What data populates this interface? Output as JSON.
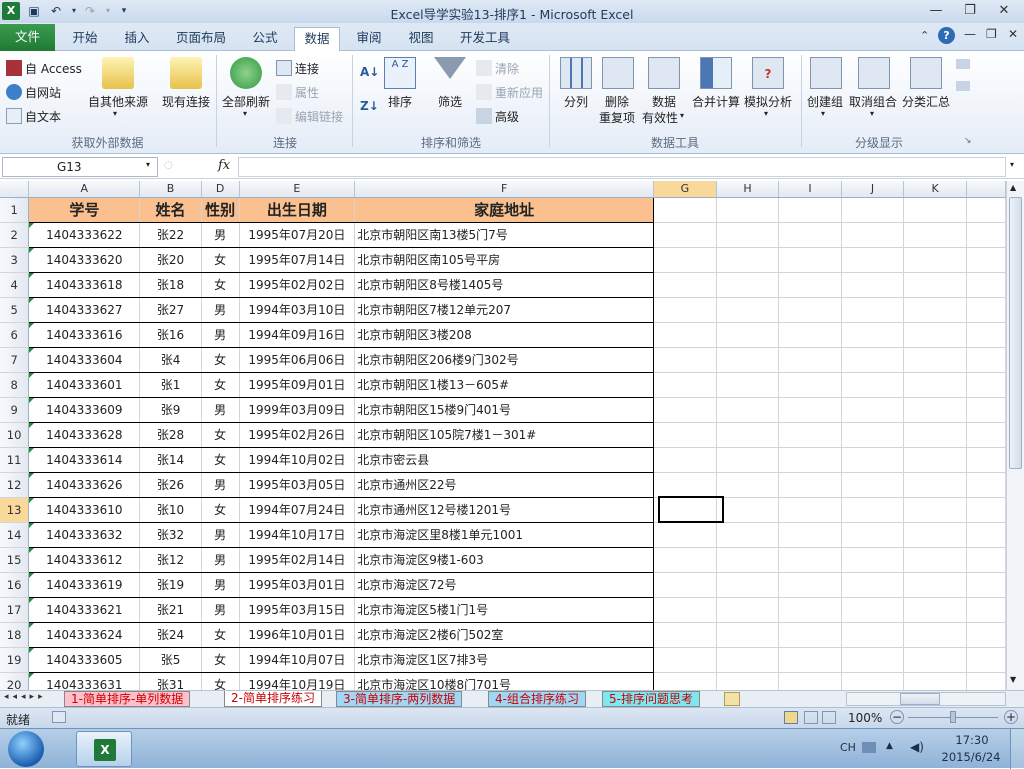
{
  "window": {
    "title": "Excel导学实验13-排序1  -  Microsoft Excel"
  },
  "tabs": [
    {
      "label": "文件"
    },
    {
      "label": "开始"
    },
    {
      "label": "插入"
    },
    {
      "label": "页面布局"
    },
    {
      "label": "公式"
    },
    {
      "label": "数据"
    },
    {
      "label": "审阅"
    },
    {
      "label": "视图"
    },
    {
      "label": "开发工具"
    }
  ],
  "ribbon": {
    "ext": {
      "access": "自 Access",
      "web": "自网站",
      "text": "自文本",
      "other": "自其他来源",
      "existing": "现有连接",
      "label": "获取外部数据"
    },
    "conn": {
      "refresh": "全部刷新",
      "connections": "连接",
      "properties": "属性",
      "edit_links": "编辑链接",
      "label": "连接"
    },
    "sort": {
      "sort": "排序",
      "filter": "筛选",
      "clear": "清除",
      "reapply": "重新应用",
      "advanced": "高级",
      "label": "排序和筛选"
    },
    "tools": {
      "split": "分列",
      "remove1": "删除",
      "remove2": "重复项",
      "valid1": "数据",
      "valid2": "有效性",
      "consolidate": "合并计算",
      "whatif": "模拟分析",
      "label": "数据工具"
    },
    "outline": {
      "group": "创建组",
      "ungroup": "取消组合",
      "subtotal": "分类汇总",
      "label": "分级显示"
    }
  },
  "formula_bar": {
    "name_box": "G13",
    "fx": "fx",
    "content": ""
  },
  "columns": [
    "A",
    "B",
    "D",
    "E",
    "F",
    "G",
    "H",
    "I",
    "J",
    "K"
  ],
  "header_row": {
    "id": "学号",
    "name": "姓名",
    "gender": "性别",
    "birth": "出生日期",
    "address": "家庭地址"
  },
  "rows": [
    {
      "n": "2",
      "id": "1404333622",
      "name": "张22",
      "g": "男",
      "b": "1995年07月20日",
      "a": "北京市朝阳区南13楼5门7号"
    },
    {
      "n": "3",
      "id": "1404333620",
      "name": "张20",
      "g": "女",
      "b": "1995年07月14日",
      "a": "北京市朝阳区南105号平房"
    },
    {
      "n": "4",
      "id": "1404333618",
      "name": "张18",
      "g": "女",
      "b": "1995年02月02日",
      "a": "北京市朝阳区8号楼1405号"
    },
    {
      "n": "5",
      "id": "1404333627",
      "name": "张27",
      "g": "男",
      "b": "1994年03月10日",
      "a": "北京市朝阳区7楼12单元207"
    },
    {
      "n": "6",
      "id": "1404333616",
      "name": "张16",
      "g": "男",
      "b": "1994年09月16日",
      "a": "北京市朝阳区3楼208"
    },
    {
      "n": "7",
      "id": "1404333604",
      "name": "张4",
      "g": "女",
      "b": "1995年06月06日",
      "a": "北京市朝阳区206楼9门302号"
    },
    {
      "n": "8",
      "id": "1404333601",
      "name": "张1",
      "g": "女",
      "b": "1995年09月01日",
      "a": "北京市朝阳区1楼13－605#"
    },
    {
      "n": "9",
      "id": "1404333609",
      "name": "张9",
      "g": "男",
      "b": "1999年03月09日",
      "a": "北京市朝阳区15楼9门401号"
    },
    {
      "n": "10",
      "id": "1404333628",
      "name": "张28",
      "g": "女",
      "b": "1995年02月26日",
      "a": "北京市朝阳区105院7楼1－301#"
    },
    {
      "n": "11",
      "id": "1404333614",
      "name": "张14",
      "g": "女",
      "b": "1994年10月02日",
      "a": "北京市密云县"
    },
    {
      "n": "12",
      "id": "1404333626",
      "name": "张26",
      "g": "男",
      "b": "1995年03月05日",
      "a": "北京市通州区22号"
    },
    {
      "n": "13",
      "id": "1404333610",
      "name": "张10",
      "g": "女",
      "b": "1994年07月24日",
      "a": "北京市通州区12号楼1201号"
    },
    {
      "n": "14",
      "id": "1404333632",
      "name": "张32",
      "g": "男",
      "b": "1994年10月17日",
      "a": "北京市海淀区里8楼1单元1001"
    },
    {
      "n": "15",
      "id": "1404333612",
      "name": "张12",
      "g": "男",
      "b": "1995年02月14日",
      "a": "北京市海淀区9楼1-603"
    },
    {
      "n": "16",
      "id": "1404333619",
      "name": "张19",
      "g": "男",
      "b": "1995年03月01日",
      "a": "北京市海淀区72号"
    },
    {
      "n": "17",
      "id": "1404333621",
      "name": "张21",
      "g": "男",
      "b": "1995年03月15日",
      "a": "北京市海淀区5楼1门1号"
    },
    {
      "n": "18",
      "id": "1404333624",
      "name": "张24",
      "g": "女",
      "b": "1996年10月01日",
      "a": "北京市海淀区2楼6门502室"
    },
    {
      "n": "19",
      "id": "1404333605",
      "name": "张5",
      "g": "女",
      "b": "1994年10月07日",
      "a": "北京市海淀区1区7排3号"
    },
    {
      "n": "20",
      "id": "1404333631",
      "name": "张31",
      "g": "女",
      "b": "1994年10月19日",
      "a": "北京市海淀区10楼8门701号"
    }
  ],
  "sheet_tabs": [
    {
      "label": "1-简单排序-单列数据",
      "color": "#ffc0cb"
    },
    {
      "label": "2-简单排序练习",
      "color": "#ffffff"
    },
    {
      "label": "3-简单排序-两列数据",
      "color": "#9fd7f5"
    },
    {
      "label": "4-组合排序练习",
      "color": "#9fd7f5"
    },
    {
      "label": "5-排序问题思考",
      "color": "#7fe7f0"
    }
  ],
  "status": {
    "ready": "就绪",
    "zoom": "100%"
  },
  "taskbar": {
    "lang": "CH",
    "time": "17:30",
    "date": "2015/6/24"
  },
  "colors": {
    "accent_green": "#1f7a3a",
    "header_fill": "#fac090",
    "selected_col": "#f9d99a"
  }
}
